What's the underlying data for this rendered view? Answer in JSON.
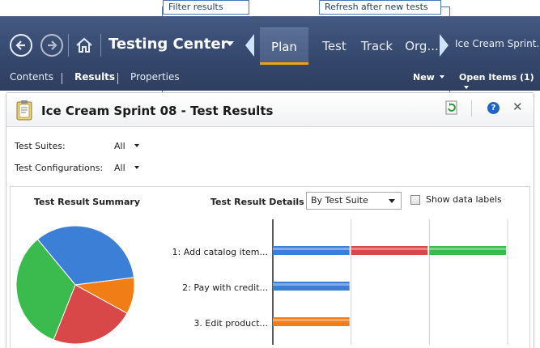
{
  "callouts": {
    "filter": "Filter results",
    "refresh": "Refresh after new tests"
  },
  "nav": {
    "back_icon": "back-arrow-icon",
    "forward_icon": "forward-arrow-icon",
    "home_icon": "home-icon",
    "app_title": "Testing Center",
    "tabs": [
      {
        "label": "Plan",
        "active": true
      },
      {
        "label": "Test",
        "active": false
      },
      {
        "label": "Track",
        "active": false
      },
      {
        "label": "Org...",
        "active": false
      }
    ],
    "breadcrumb": "Ice Cream Sprint..."
  },
  "subnav": {
    "items": [
      {
        "label": "Contents",
        "active": false
      },
      {
        "label": "Results",
        "active": true
      },
      {
        "label": "Properties",
        "active": false
      }
    ],
    "new_menu": "New",
    "open_items_menu": "Open Items (1)"
  },
  "panel": {
    "title": "Ice Cream Sprint 08 - Test Results",
    "help_glyph": "?",
    "close_glyph": "✕",
    "filters": [
      {
        "label": "Test Suites:",
        "value": "All"
      },
      {
        "label": "Test Configurations:",
        "value": "All"
      }
    ]
  },
  "summary": {
    "title": "Test Result Summary"
  },
  "details": {
    "title": "Test Result Details",
    "group_by": "By Test Suite",
    "show_data_labels": "Show data labels",
    "show_data_labels_checked": false
  },
  "colors": {
    "passed": "#3c7fd6",
    "failed": "#d94848",
    "active": "#3bbb4d",
    "blocked": "#f07d16"
  },
  "chart_data": [
    {
      "type": "pie",
      "title": "Test Result Summary",
      "slices": [
        {
          "color": "#3c7fd6",
          "value": 34
        },
        {
          "color": "#f07d16",
          "value": 10
        },
        {
          "color": "#d94848",
          "value": 23
        },
        {
          "color": "#3bbb4d",
          "value": 33
        }
      ]
    },
    {
      "type": "bar",
      "orientation": "horizontal",
      "stacked": true,
      "title": "Test Result Details",
      "categories": [
        "1: Add catalog item...",
        "2: Pay with credit...",
        "3. Edit product..."
      ],
      "series": [
        {
          "color": "#3c7fd6",
          "values": [
            1,
            1,
            0
          ]
        },
        {
          "color": "#d94848",
          "values": [
            1,
            0,
            0
          ]
        },
        {
          "color": "#3bbb4d",
          "values": [
            1,
            0,
            0
          ]
        },
        {
          "color": "#f07d16",
          "values": [
            0,
            0,
            1
          ]
        }
      ],
      "xlim": [
        0,
        3
      ]
    }
  ]
}
